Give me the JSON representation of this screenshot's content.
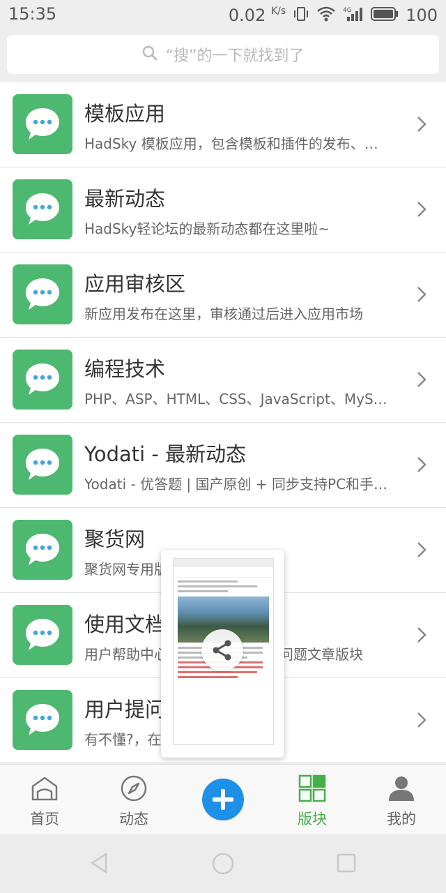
{
  "status_bar": {
    "time": "15:35",
    "net_speed": "0.02",
    "net_unit": "K/s",
    "battery": "100"
  },
  "search": {
    "placeholder": "“搜”的一下就找到了"
  },
  "boards": [
    {
      "title": "模板应用",
      "desc": "HadSky 模板应用，包含模板和插件的发布、…"
    },
    {
      "title": "最新动态",
      "desc": "HadSky轻论坛的最新动态都在这里啦~"
    },
    {
      "title": "应用审核区",
      "desc": "新应用发布在这里，审核通过后进入应用市场"
    },
    {
      "title": "编程技术",
      "desc": "PHP、ASP、HTML、CSS、JavaScript、MySQ…"
    },
    {
      "title": "Yodati - 最新动态",
      "desc": "Yodati - 优答题 | 国产原创 + 同步支持PC和手…"
    },
    {
      "title": "聚货网",
      "desc": "聚货网专用版块"
    },
    {
      "title": "使用文档",
      "desc": "用户帮助中心，使用文档及常见问题文章版块"
    },
    {
      "title": "用户提问",
      "desc": "有不懂?，在这里提问吧"
    }
  ],
  "nav": {
    "home": "首页",
    "feed": "动态",
    "boards": "版块",
    "me": "我的"
  },
  "colors": {
    "accent_green": "#45b04a",
    "icon_green": "#4db870",
    "plus_blue": "#1e90e8"
  }
}
